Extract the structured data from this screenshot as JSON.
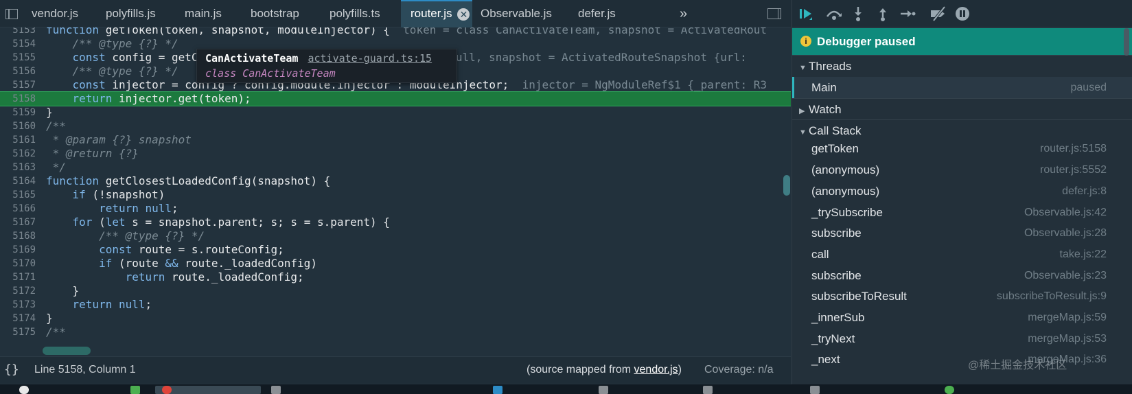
{
  "tabs": [
    {
      "label": "vendor.js",
      "active": false
    },
    {
      "label": "polyfills.js",
      "active": false
    },
    {
      "label": "main.js",
      "active": false
    },
    {
      "label": "bootstrap",
      "active": false
    },
    {
      "label": "polyfills.ts",
      "active": false
    },
    {
      "label": "router.js",
      "active": true
    },
    {
      "label": "Observable.js",
      "active": false
    },
    {
      "label": "defer.js",
      "active": false
    }
  ],
  "tab_overflow": "»",
  "code_lines": [
    {
      "n": "5153"
    },
    {
      "n": "5154"
    },
    {
      "n": "5155"
    },
    {
      "n": "5156"
    },
    {
      "n": "5157"
    },
    {
      "n": "5158"
    },
    {
      "n": "5159"
    },
    {
      "n": "5160"
    },
    {
      "n": "5161"
    },
    {
      "n": "5162"
    },
    {
      "n": "5163"
    },
    {
      "n": "5164"
    },
    {
      "n": "5165"
    },
    {
      "n": "5166"
    },
    {
      "n": "5167"
    },
    {
      "n": "5168"
    },
    {
      "n": "5169"
    },
    {
      "n": "5170"
    },
    {
      "n": "5171"
    },
    {
      "n": "5172"
    },
    {
      "n": "5173"
    },
    {
      "n": "5174"
    },
    {
      "n": "5175"
    }
  ],
  "code_text": {
    "l5153_a": "function",
    "l5153_b": " getToken(token, snapshot, moduleInjector) {",
    "l5153_inline": "  token = class CanActivateTeam, snapshot = ActivatedRout",
    "l5154": "    /** @type {?} */",
    "l5155_a": "    const",
    "l5155_b": " config = getC",
    "l5155_inline": "= null, snapshot = ActivatedRouteSnapshot {url:",
    "l5156": "    /** @type {?} */",
    "l5157_a": "    const",
    "l5157_b": " injector = config ? config.module.injector : moduleInjector;",
    "l5157_inline": "  injector = NgModuleRef$1 {_parent: R3",
    "l5158_a": "    return",
    "l5158_b": " injector.get(token);",
    "l5159": "}",
    "l5160": "/**",
    "l5161": " * @param {?} snapshot",
    "l5162": " * @return {?}",
    "l5163": " */",
    "l5164_a": "function",
    "l5164_b": " getClosestLoadedConfig(snapshot) {",
    "l5165_a": "    if",
    "l5165_b": " (!snapshot)",
    "l5166_a": "        return null",
    "l5166_b": ";",
    "l5167_a": "    for",
    "l5167_b": " (",
    "l5167_c": "let",
    "l5167_d": " s = snapshot.parent; s; s = s.parent) {",
    "l5168": "        /** @type {?} */",
    "l5169_a": "        const",
    "l5169_b": " route = s.routeConfig;",
    "l5170_a": "        if",
    "l5170_b": " (route ",
    "l5170_c": "&&",
    "l5170_d": " route._loadedConfig)",
    "l5171_a": "            return",
    "l5171_b": " route._loadedConfig;",
    "l5172": "    }",
    "l5173_a": "    return null",
    "l5173_b": ";",
    "l5174": "}",
    "l5175": "/**"
  },
  "tooltip": {
    "name": "CanActivateTeam",
    "source": "activate-guard.ts:15",
    "kind": "class",
    "value": "CanActivateTeam"
  },
  "status": {
    "pretty_print": "{}",
    "cursor": "Line 5158, Column 1",
    "source_prefix": "(source mapped from ",
    "source_file": "vendor.js",
    "source_suffix": ")",
    "coverage": "Coverage: n/a"
  },
  "debugger": {
    "paused_label": "Debugger paused",
    "threads_label": "Threads",
    "thread": {
      "name": "Main",
      "state": "paused"
    },
    "watch_label": "Watch",
    "callstack_label": "Call Stack",
    "frames": [
      {
        "fn": "getToken",
        "loc": "router.js:5158"
      },
      {
        "fn": "(anonymous)",
        "loc": "router.js:5552"
      },
      {
        "fn": "(anonymous)",
        "loc": "defer.js:8"
      },
      {
        "fn": "_trySubscribe",
        "loc": "Observable.js:42"
      },
      {
        "fn": "subscribe",
        "loc": "Observable.js:28"
      },
      {
        "fn": "call",
        "loc": "take.js:22"
      },
      {
        "fn": "subscribe",
        "loc": "Observable.js:23"
      },
      {
        "fn": "subscribeToResult",
        "loc": "subscribeToResult.js:9"
      },
      {
        "fn": "_innerSub",
        "loc": "mergeMap.js:59"
      },
      {
        "fn": "_tryNext",
        "loc": "mergeMap.js:53"
      },
      {
        "fn": "_next",
        "loc": "mergeMap.js:36"
      }
    ]
  },
  "watermark": "@稀土掘金技术社区",
  "colors": {
    "exec_line": "#1c7a3e",
    "paused_banner": "#0f8a7c",
    "active_tab": "#2c4a5a",
    "keyword": "#7fb7ea"
  }
}
